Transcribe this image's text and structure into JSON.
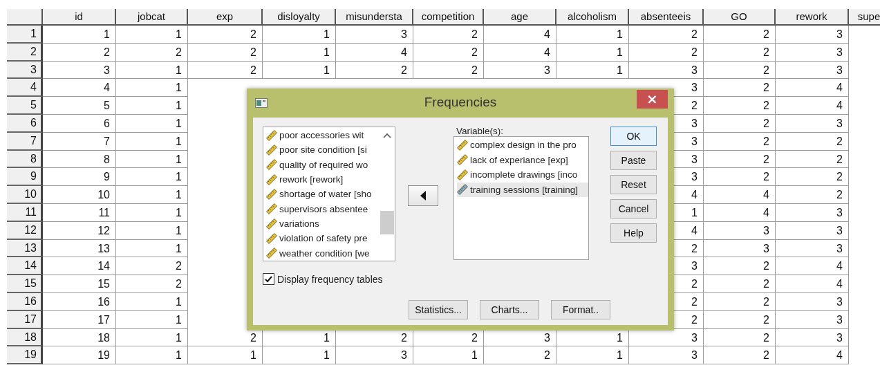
{
  "data_grid": {
    "columns": [
      "id",
      "jobcat",
      "exp",
      "disloyalty",
      "misundersta",
      "competition",
      "age",
      "alcoholism",
      "absenteeis",
      "GO",
      "rework",
      "supe"
    ],
    "rows": [
      {
        "number": "1",
        "cells": [
          "1",
          "1",
          "2",
          "1",
          "3",
          "2",
          "4",
          "1",
          "2",
          "2",
          "3"
        ]
      },
      {
        "number": "2",
        "cells": [
          "2",
          "2",
          "2",
          "1",
          "4",
          "2",
          "4",
          "1",
          "2",
          "2",
          "3"
        ]
      },
      {
        "number": "3",
        "cells": [
          "3",
          "1",
          "2",
          "1",
          "2",
          "2",
          "3",
          "1",
          "3",
          "2",
          "3"
        ]
      },
      {
        "number": "4",
        "cells": [
          "4",
          "1",
          null,
          null,
          null,
          null,
          null,
          null,
          "3",
          "2",
          "4"
        ]
      },
      {
        "number": "5",
        "cells": [
          "5",
          "1",
          null,
          null,
          null,
          null,
          null,
          null,
          "2",
          "2",
          "4"
        ]
      },
      {
        "number": "6",
        "cells": [
          "6",
          "1",
          null,
          null,
          null,
          null,
          null,
          null,
          "3",
          "2",
          "3"
        ]
      },
      {
        "number": "7",
        "cells": [
          "7",
          "1",
          null,
          null,
          null,
          null,
          null,
          null,
          "3",
          "2",
          "2"
        ]
      },
      {
        "number": "8",
        "cells": [
          "8",
          "1",
          null,
          null,
          null,
          null,
          null,
          null,
          "3",
          "2",
          "2"
        ]
      },
      {
        "number": "9",
        "cells": [
          "9",
          "1",
          null,
          null,
          null,
          null,
          null,
          null,
          "3",
          "2",
          "2"
        ]
      },
      {
        "number": "10",
        "cells": [
          "10",
          "1",
          null,
          null,
          null,
          null,
          null,
          null,
          "4",
          "4",
          "2"
        ]
      },
      {
        "number": "11",
        "cells": [
          "11",
          "1",
          null,
          null,
          null,
          null,
          null,
          null,
          "1",
          "4",
          "3"
        ]
      },
      {
        "number": "12",
        "cells": [
          "12",
          "1",
          null,
          null,
          null,
          null,
          null,
          null,
          "4",
          "3",
          "3"
        ]
      },
      {
        "number": "13",
        "cells": [
          "13",
          "1",
          null,
          null,
          null,
          null,
          null,
          null,
          "2",
          "3",
          "3"
        ]
      },
      {
        "number": "14",
        "cells": [
          "14",
          "2",
          null,
          null,
          null,
          null,
          null,
          null,
          "3",
          "2",
          "4"
        ]
      },
      {
        "number": "15",
        "cells": [
          "15",
          "2",
          null,
          null,
          null,
          null,
          null,
          null,
          "2",
          "2",
          "4"
        ]
      },
      {
        "number": "16",
        "cells": [
          "16",
          "1",
          null,
          null,
          null,
          null,
          null,
          null,
          "2",
          "2",
          "3"
        ]
      },
      {
        "number": "17",
        "cells": [
          "17",
          "1",
          null,
          null,
          null,
          null,
          null,
          null,
          "2",
          "2",
          "3"
        ]
      },
      {
        "number": "18",
        "cells": [
          "18",
          "1",
          "2",
          "1",
          "2",
          "2",
          "3",
          "1",
          "3",
          "2",
          "3"
        ]
      },
      {
        "number": "19",
        "cells": [
          "19",
          "1",
          "1",
          "1",
          "3",
          "1",
          "2",
          "1",
          "3",
          "2",
          "4"
        ]
      }
    ]
  },
  "dialog": {
    "title": "Frequencies",
    "close": "×",
    "source_list": [
      {
        "label": "poor accessories wit",
        "selected": false
      },
      {
        "label": "poor site condition [si",
        "selected": false
      },
      {
        "label": "quality of required wo",
        "selected": false
      },
      {
        "label": "rework [rework]",
        "selected": false
      },
      {
        "label": "shortage of water [sho",
        "selected": false
      },
      {
        "label": "supervisors absentee",
        "selected": false
      },
      {
        "label": "variations",
        "selected": false
      },
      {
        "label": "violation of safety pre",
        "selected": false
      },
      {
        "label": "weather condition [we",
        "selected": false
      }
    ],
    "variables_label": "Variable(s):",
    "variables": [
      {
        "label": "complex design in the pro",
        "selected": false
      },
      {
        "label": "lack of experiance [exp]",
        "selected": false
      },
      {
        "label": "incomplete drawings [inco",
        "selected": false
      },
      {
        "label": "training sessions [training]",
        "selected": true
      }
    ],
    "side_buttons": [
      {
        "label": "OK",
        "default": true
      },
      {
        "label": "Paste",
        "default": false
      },
      {
        "label": "Reset",
        "default": false
      },
      {
        "label": "Cancel",
        "default": false
      },
      {
        "label": "Help",
        "default": false
      }
    ],
    "checkbox": {
      "label": "Display frequency tables",
      "checked": true
    },
    "bottom_buttons": [
      "Statistics...",
      "Charts...",
      "Format.."
    ]
  }
}
